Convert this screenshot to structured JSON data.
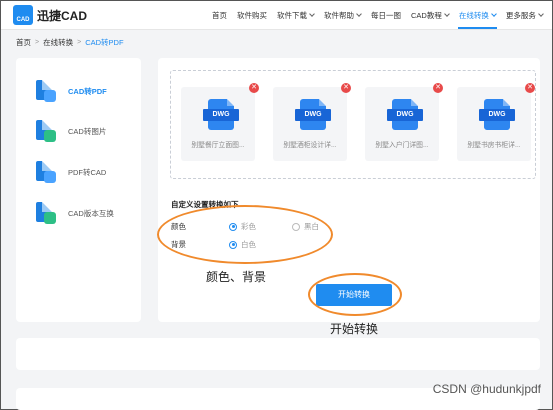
{
  "header": {
    "logo_mark": "CAD",
    "logo_text": "迅捷CAD",
    "nav": [
      {
        "label": "首页",
        "dropdown": false,
        "active": false
      },
      {
        "label": "软件购买",
        "dropdown": false,
        "active": false
      },
      {
        "label": "软件下载",
        "dropdown": true,
        "active": false
      },
      {
        "label": "软件帮助",
        "dropdown": true,
        "active": false
      },
      {
        "label": "每日一图",
        "dropdown": false,
        "active": false
      },
      {
        "label": "CAD教程",
        "dropdown": true,
        "active": false
      },
      {
        "label": "在线转换",
        "dropdown": true,
        "active": true
      },
      {
        "label": "更多服务",
        "dropdown": true,
        "active": false
      }
    ]
  },
  "breadcrumb": {
    "home": "首页",
    "section": "在线转换",
    "current": "CAD转PDF",
    "separator": ">"
  },
  "sidebar": {
    "items": [
      {
        "label": "CAD转PDF",
        "active": true,
        "icon": "cad-to-pdf-icon"
      },
      {
        "label": "CAD转图片",
        "active": false,
        "icon": "cad-to-image-icon"
      },
      {
        "label": "PDF转CAD",
        "active": false,
        "icon": "pdf-to-cad-icon"
      },
      {
        "label": "CAD版本互换",
        "active": false,
        "icon": "cad-version-icon"
      }
    ]
  },
  "files": [
    {
      "type": "DWG",
      "name": "别墅餐厅立面图..."
    },
    {
      "type": "DWG",
      "name": "别墅酒柜设计详..."
    },
    {
      "type": "DWG",
      "name": "别墅入户门详图..."
    },
    {
      "type": "DWG",
      "name": "别墅书房书柜详..."
    }
  ],
  "settings": {
    "title": "自定义设置转换如下",
    "color_label": "颜色",
    "color_options": [
      {
        "label": "彩色",
        "selected": true
      },
      {
        "label": "黑白",
        "selected": false
      }
    ],
    "background_label": "背景",
    "background_options": [
      {
        "label": "白色",
        "selected": true
      }
    ]
  },
  "start_button": "开始转换",
  "annotations": {
    "settings_note": "颜色、背景",
    "button_note": "开始转换"
  },
  "watermark": "CSDN @hudunkjpdf",
  "colors": {
    "accent": "#1f8cf0",
    "annotation": "#f08a2c",
    "delete": "#e84a4a"
  }
}
